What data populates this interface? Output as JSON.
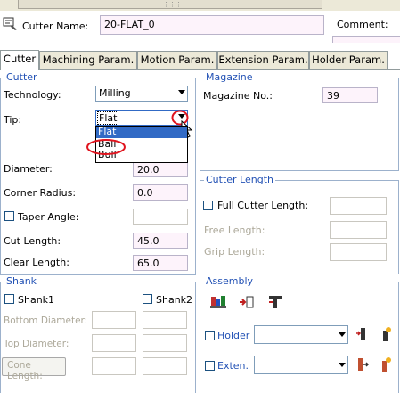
{
  "header": {
    "cutter_name_label": "Cutter Name:",
    "cutter_name_value": "20-FLAT_0",
    "comment_label": "Comment:",
    "comment_value": ""
  },
  "tabs": [
    {
      "label": "Cutter",
      "active": true
    },
    {
      "label": "Machining Param.",
      "active": false
    },
    {
      "label": "Motion Param.",
      "active": false
    },
    {
      "label": "Extension Param.",
      "active": false
    },
    {
      "label": "Holder Param.",
      "active": false
    }
  ],
  "cutter": {
    "title": "Cutter",
    "technology_label": "Technology:",
    "technology_value": "Milling",
    "tip_label": "Tip:",
    "tip_value": "Flat",
    "tip_options": [
      "Flat",
      "Ball",
      "Bull"
    ],
    "diameter_label": "Diameter:",
    "diameter_value": "20.0",
    "corner_radius_label": "Corner Radius:",
    "corner_radius_value": "0.0",
    "taper_angle_label": "Taper Angle:",
    "cut_length_label": "Cut Length:",
    "cut_length_value": "45.0",
    "clear_length_label": "Clear Length:",
    "clear_length_value": "65.0"
  },
  "magazine": {
    "title": "Magazine",
    "label": "Magazine No.:",
    "value": "39"
  },
  "cutter_length": {
    "title": "Cutter Length",
    "full_label": "Full Cutter Length:",
    "free_label": "Free Length:",
    "grip_label": "Grip Length:"
  },
  "shank": {
    "title": "Shank",
    "shank1_label": "Shank1",
    "shank2_label": "Shank2",
    "bottom_diameter_label": "Bottom Diameter:",
    "top_diameter_label": "Top Diameter:",
    "cone_length_label": "Cone Length:"
  },
  "assembly": {
    "title": "Assembly",
    "holder_label": "Holder",
    "exten_label": "Exten."
  },
  "colors": {
    "accent": "#2352b5",
    "highlight": "#316ac5",
    "annotation": "#e0141e",
    "field_bg": "#fdf3fb"
  }
}
